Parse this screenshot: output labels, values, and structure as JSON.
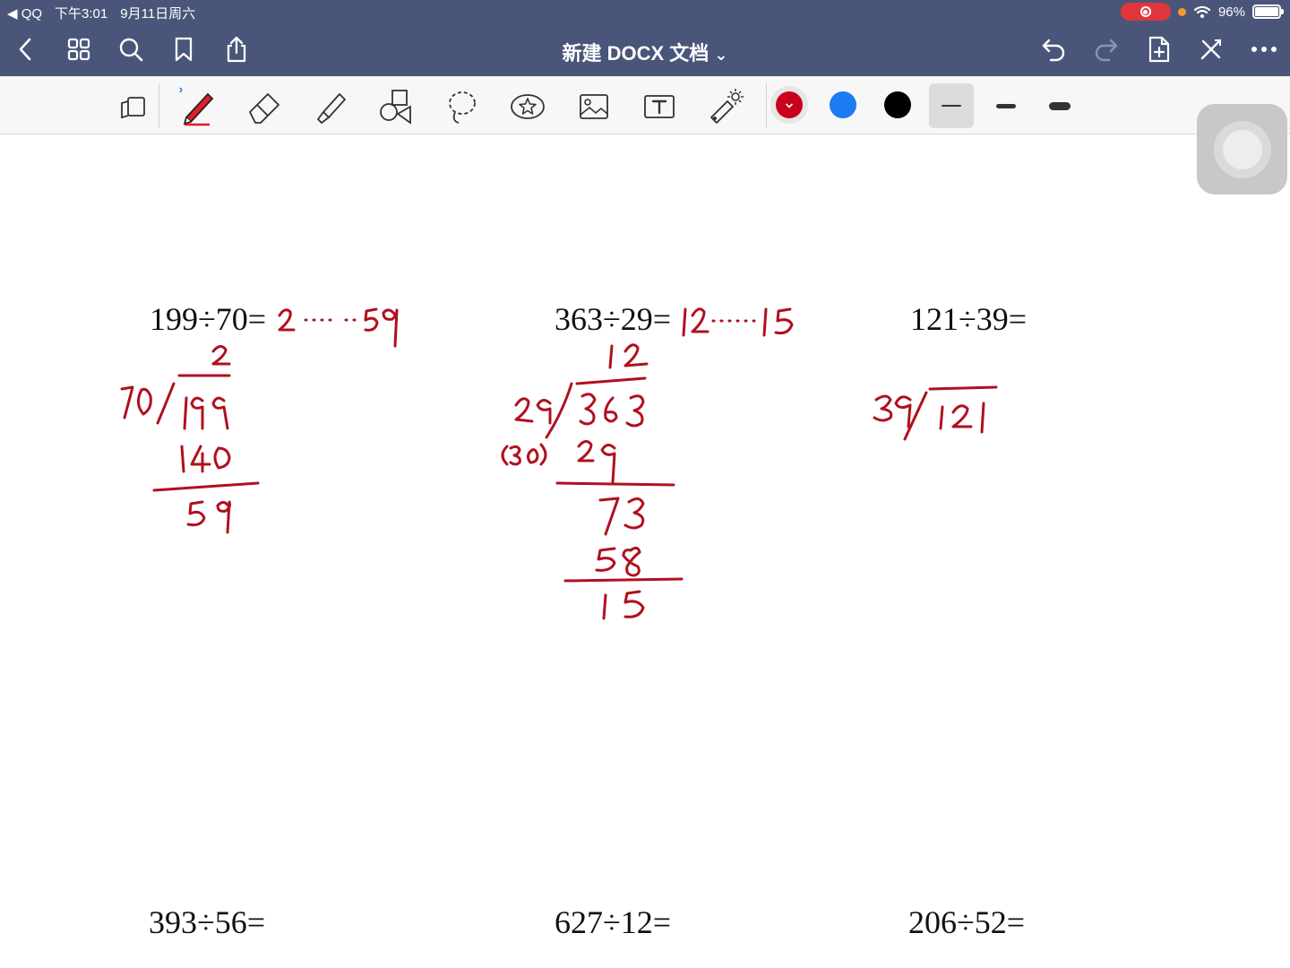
{
  "status_bar": {
    "back_app": "◀ QQ",
    "time": "下午3:01",
    "date": "9月11日周六",
    "battery": "96%"
  },
  "nav": {
    "title": "新建 DOCX 文档",
    "title_chevron": "⌄"
  },
  "toolbar": {
    "tools": [
      "page-view",
      "pen",
      "eraser",
      "highlighter",
      "shapes",
      "lasso",
      "sticker",
      "image",
      "text",
      "laser-pointer"
    ],
    "colors": [
      "#c8001e",
      "#1a7cf0",
      "#000000"
    ],
    "selected_color": "#c8001e",
    "stroke_widths": [
      "thin",
      "medium",
      "thick"
    ],
    "selected_stroke": "thin"
  },
  "problems": [
    {
      "expr": "199÷70="
    },
    {
      "expr": "363÷29="
    },
    {
      "expr": "121÷39="
    },
    {
      "expr": "393÷56="
    },
    {
      "expr": "627÷12="
    },
    {
      "expr": "206÷52="
    }
  ],
  "handwriting": {
    "p1_answer": "2……59",
    "p1_work": [
      "2",
      "70)199",
      "140",
      "59"
    ],
    "p2_answer": "12……15",
    "p2_work": [
      "12",
      "29)363",
      "(30)",
      "29",
      "73",
      "58",
      "15"
    ],
    "p3_work": [
      "39)121"
    ]
  }
}
